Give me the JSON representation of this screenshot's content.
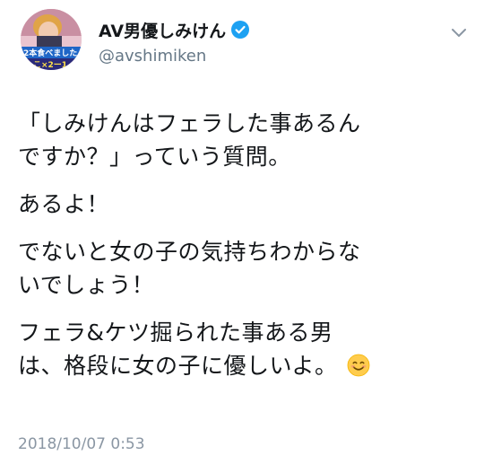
{
  "user": {
    "display_name": "AV男優しみけん",
    "handle": "@avshimiken",
    "verified": true,
    "avatar_caption_1": "2本食べました",
    "avatar_caption_2": "こ×2ー1"
  },
  "tweet": {
    "paragraphs": [
      [
        "「しみけんはフェラした事あるん",
        "ですか？」っていう質問。"
      ],
      [
        "あるよ！"
      ],
      [
        "でないと女の子の気持ちわからな",
        "いでしょう！"
      ],
      [
        "フェラ&ケツ掘られた事ある男",
        "は、格段に女の子に優しいよ。"
      ]
    ],
    "emoji": "smiling-face-emoji",
    "timestamp": "2018/10/07 0:53"
  },
  "icons": {
    "verified": "verified-badge-icon",
    "menu": "chevron-down-icon"
  },
  "colors": {
    "text": "#14171a",
    "secondary": "#657786",
    "verified": "#1da1f2",
    "timestamp": "#8a96a3"
  }
}
